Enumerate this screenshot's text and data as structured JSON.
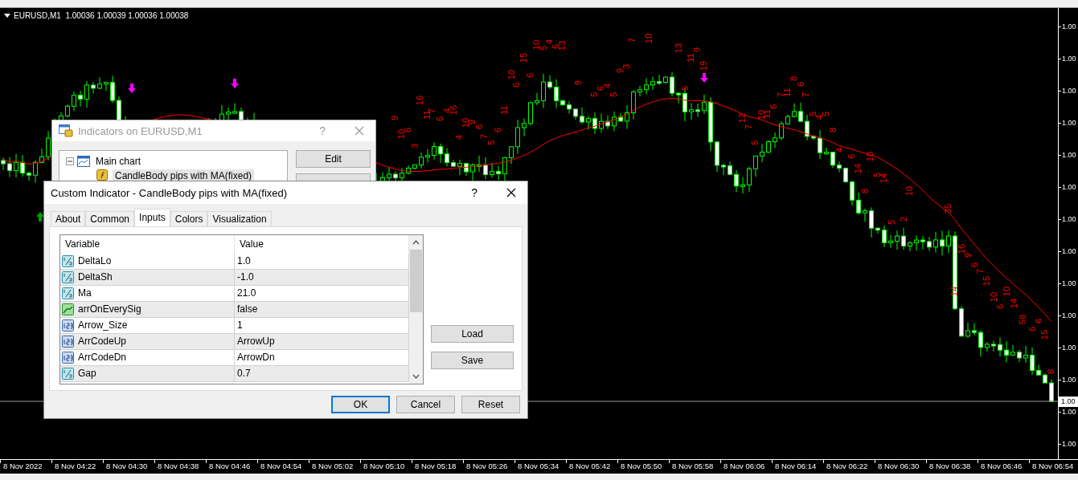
{
  "chart": {
    "header": "EURUSD,M1  1.00036 1.00039 1.00036 1.00038",
    "price_labels": [
      "1.00",
      "1.00",
      "1.00",
      "1.00",
      "1.00",
      "1.00",
      "1.00",
      "1.00",
      "1.00",
      "1.00",
      "1.00",
      "1.00",
      "1.00",
      "1.00"
    ],
    "current_price": "1.00",
    "time_labels": [
      "8 Nov 2022",
      "8 Nov 04:22",
      "8 Nov 04:30",
      "8 Nov 04:38",
      "8 Nov 04:46",
      "8 Nov 04:54",
      "8 Nov 05:02",
      "8 Nov 05:10",
      "8 Nov 05:18",
      "8 Nov 05:26",
      "8 Nov 05:34",
      "8 Nov 05:42",
      "8 Nov 05:50",
      "8 Nov 05:58",
      "8 Nov 06:06",
      "8 Nov 06:14",
      "8 Nov 06:22",
      "8 Nov 06:30",
      "8 Nov 06:38",
      "8 Nov 06:46",
      "8 Nov 06:54"
    ],
    "pip_labels": [
      "9",
      "10",
      "6",
      "3",
      "16",
      "11",
      "7",
      "6",
      "4",
      "16",
      "4",
      "10",
      "9",
      "6",
      "7",
      "5",
      "6",
      "11",
      "10",
      "6",
      "15",
      "6",
      "10",
      "5",
      "4",
      "6",
      "13",
      "9",
      "5",
      "6",
      "4",
      "5",
      "9",
      "3",
      "7",
      "10",
      "13",
      "11",
      "9",
      "19",
      "5",
      "12",
      "7",
      "5",
      "10",
      "11",
      "6",
      "7",
      "11",
      "8",
      "6",
      "7",
      "5",
      "4",
      "5",
      "8",
      "4",
      "6",
      "14",
      "10",
      "5",
      "14",
      "8",
      "10",
      "35",
      "5",
      "2",
      "16",
      "9",
      "6",
      "7",
      "15",
      "14",
      "10",
      "6",
      "10",
      "14",
      "58",
      "6",
      "6",
      "15",
      "8"
    ]
  },
  "indicators_dialog": {
    "title": "Indicators on EURUSD,M1",
    "help": "?",
    "tree": [
      {
        "label": "Main chart",
        "expanded": true,
        "children": [
          {
            "label": "CandleBody pips with MA(fixed)",
            "selected": true
          }
        ]
      }
    ],
    "buttons": [
      "Edit"
    ]
  },
  "custom_dialog": {
    "title": "Custom Indicator - CandleBody pips with MA(fixed)",
    "help": "?",
    "tabs": [
      {
        "label": "About",
        "selected": false
      },
      {
        "label": "Common",
        "selected": false
      },
      {
        "label": "Inputs",
        "selected": true
      },
      {
        "label": "Colors",
        "selected": false
      },
      {
        "label": "Visualization",
        "selected": false
      }
    ],
    "columns": [
      "Variable",
      "Value"
    ],
    "rows": [
      {
        "kind": "double",
        "variable": "DeltaLo",
        "value": "1.0"
      },
      {
        "kind": "double",
        "variable": "DeltaSh",
        "value": "-1.0"
      },
      {
        "kind": "double",
        "variable": "Ma",
        "value": "21.0"
      },
      {
        "kind": "bool",
        "variable": "arrOnEverySig",
        "value": "false"
      },
      {
        "kind": "int",
        "variable": "Arrow_Size",
        "value": "1"
      },
      {
        "kind": "int",
        "variable": "ArrCodeUp",
        "value": "ArrowUp"
      },
      {
        "kind": "int",
        "variable": "ArrCodeDn",
        "value": "ArrowDn"
      },
      {
        "kind": "double",
        "variable": "Gap",
        "value": "0.7"
      }
    ],
    "side_buttons": [
      "Load",
      "Save"
    ],
    "buttons": [
      {
        "label": "OK",
        "default": true
      },
      {
        "label": "Cancel",
        "default": false
      },
      {
        "label": "Reset",
        "default": false
      }
    ]
  }
}
